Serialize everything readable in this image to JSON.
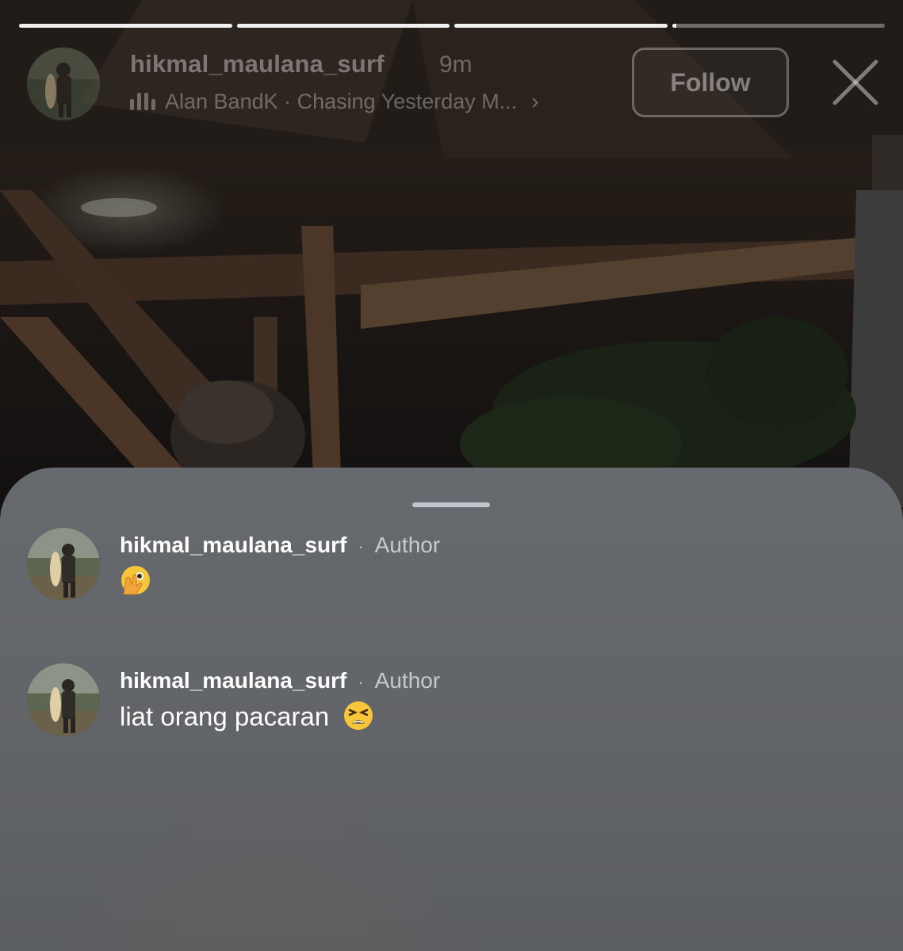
{
  "story": {
    "progress_segments": [
      1,
      1,
      1,
      0.02
    ],
    "username": "hikmal_maulana_surf",
    "time_ago": "9m",
    "music": {
      "icon": "music-bars-icon",
      "text": "Alan BandK · Chasing Yesterday M...",
      "chevron": "›"
    },
    "follow_label": "Follow",
    "close_icon": "close-icon"
  },
  "comments": [
    {
      "username": "hikmal_maulana_surf",
      "separator": "·",
      "badge": "Author",
      "text": "",
      "emoji": "face-with-open-eyes-and-hand-over-mouth"
    },
    {
      "username": "hikmal_maulana_surf",
      "separator": "·",
      "badge": "Author",
      "text": "liat orang pacaran",
      "emoji": "tired-face"
    }
  ],
  "colors": {
    "sheet_bg": "#63666a",
    "text_primary": "#ffffff",
    "text_secondary": "#e6ebf0",
    "emoji_yellow": "#f7c53a"
  }
}
